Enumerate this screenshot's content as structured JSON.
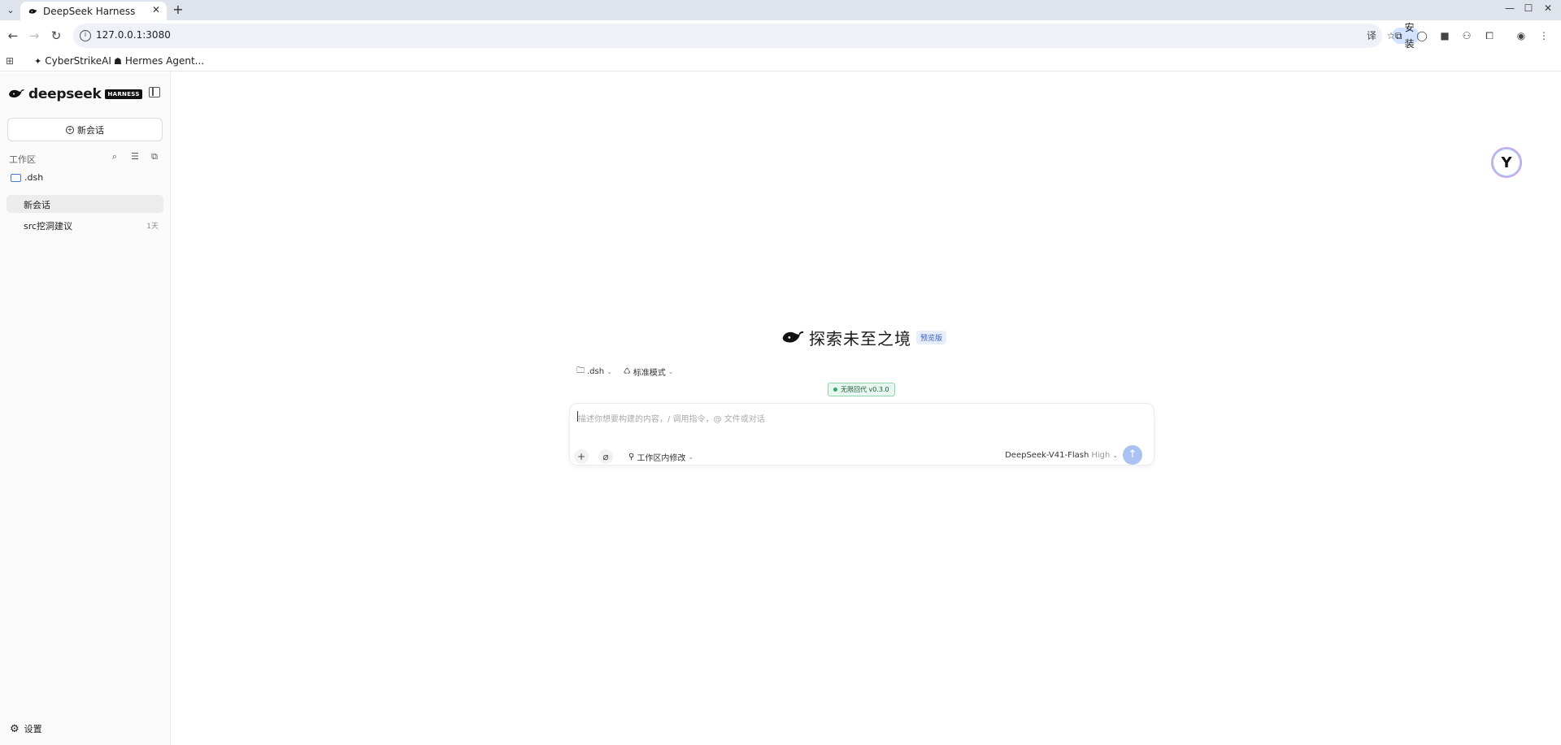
{
  "browser": {
    "tab_title": "DeepSeek Harness",
    "url": "127.0.0.1:3080",
    "install_label": "安装",
    "bookmarks": [
      "CyberStrikeAI",
      "Hermes Agent..."
    ]
  },
  "sidebar": {
    "brand_name": "deepseek",
    "brand_badge": "HARNESS",
    "new_chat_label": "新会话",
    "workspace_label": "工作区",
    "folder_name": ".dsh",
    "conversations": [
      {
        "label": "新会话",
        "meta": ""
      },
      {
        "label": "src挖洞建议",
        "meta": "1天"
      }
    ],
    "settings_label": "设置"
  },
  "main": {
    "hero_title": "探索未至之境",
    "preview_badge": "预览版",
    "folder_selector": ".dsh",
    "mode_selector": "标准模式",
    "version_pill": "无限回代 v0.3.0",
    "composer": {
      "placeholder": "描述你想要构建的内容，/ 调用指令，@ 文件或对话",
      "workspace_edit": "工作区内修改",
      "model": "DeepSeek-V41-Flash",
      "level": "High"
    }
  },
  "colors": {
    "accent": "#4a79d8",
    "send_button": "#a9c2f2",
    "version_green": "#2fa866"
  }
}
